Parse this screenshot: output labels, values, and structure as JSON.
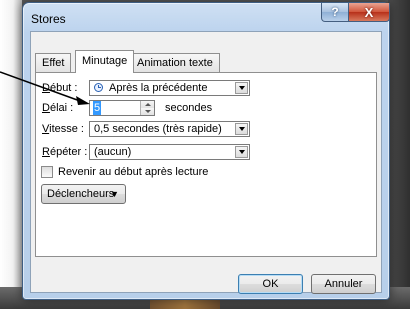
{
  "window": {
    "title": "Stores",
    "help_label": "?",
    "close_label": "X"
  },
  "tabs": [
    {
      "label": "Effet",
      "active": false
    },
    {
      "label": "Minutage",
      "active": true
    },
    {
      "label": "Animation texte",
      "active": false
    }
  ],
  "form": {
    "debut": {
      "label_pre": "",
      "label_u": "D",
      "label_post": "ébut :",
      "value": "Après la précédente",
      "icon": "clock-icon"
    },
    "delai": {
      "label_pre": "",
      "label_u": "D",
      "label_post": "élai :",
      "value": "5",
      "unit": "secondes"
    },
    "vitesse": {
      "label_pre": "",
      "label_u": "V",
      "label_post": "itesse :",
      "value": "0,5 secondes (très rapide)"
    },
    "repeter": {
      "label_pre": "",
      "label_u": "R",
      "label_post": "épéter :",
      "value": "(aucun)"
    },
    "rewind": {
      "label": "Revenir au début après lecture",
      "checked": false
    },
    "triggers": {
      "label": "Déclencheurs"
    }
  },
  "buttons": {
    "ok": "OK",
    "cancel": "Annuler"
  },
  "colors": {
    "titlebar": "#bcd3ee",
    "close": "#c7432a",
    "selection": "#3399ff"
  }
}
